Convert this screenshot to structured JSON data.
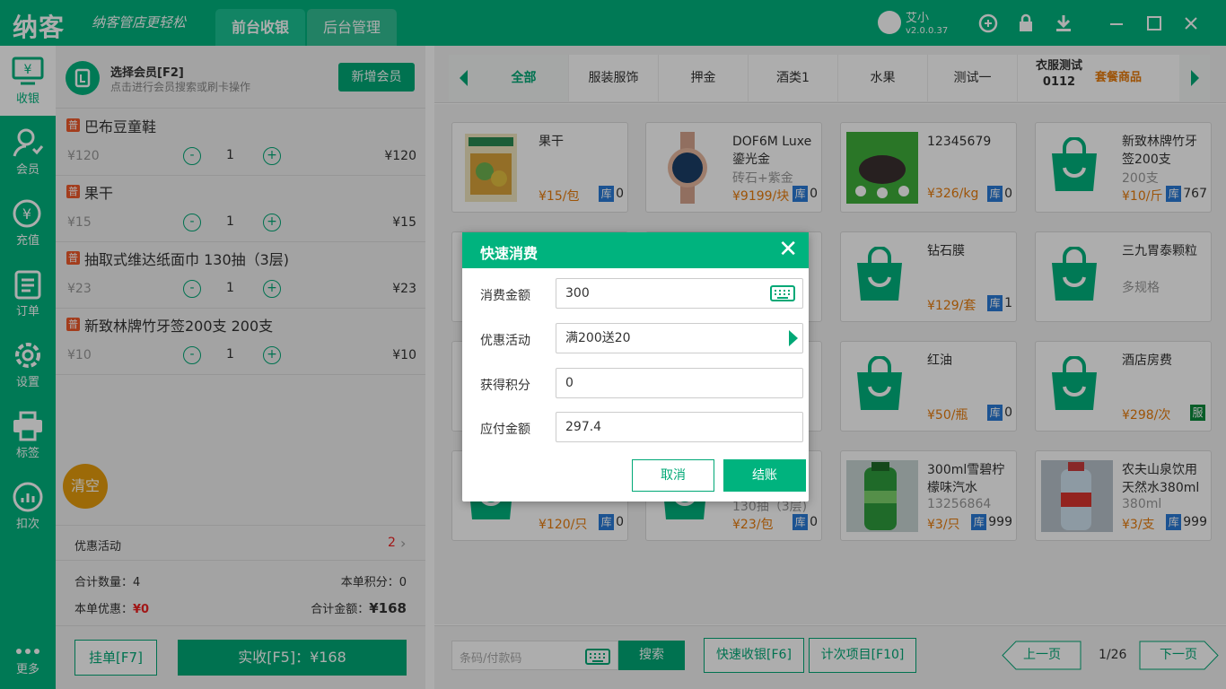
{
  "app": {
    "logo": "纳客",
    "slogan": "纳客管店更轻松",
    "tab_front": "前台收银",
    "tab_back": "后台管理",
    "user_name": "艾小",
    "version": "v2.0.0.37"
  },
  "sidebar": [
    {
      "label": "收银",
      "icon": "cashier-icon"
    },
    {
      "label": "会员",
      "icon": "member-icon"
    },
    {
      "label": "充值",
      "icon": "recharge-icon"
    },
    {
      "label": "订单",
      "icon": "order-icon"
    },
    {
      "label": "设置",
      "icon": "settings-icon"
    },
    {
      "label": "标签",
      "icon": "printer-icon"
    },
    {
      "label": "扣次",
      "icon": "chart-icon"
    },
    {
      "label": "更多",
      "icon": "more-icon"
    }
  ],
  "member": {
    "title": "选择会员[F2]",
    "subtitle": "点击进行会员搜索或刷卡操作",
    "add_label": "新增会员"
  },
  "cart": [
    {
      "tag": "普",
      "name": "巴布豆童鞋",
      "price": "¥120",
      "qty": "1",
      "total": "¥120"
    },
    {
      "tag": "普",
      "name": "果干",
      "price": "¥15",
      "qty": "1",
      "total": "¥15"
    },
    {
      "tag": "普",
      "name": "抽取式维达纸面巾 130抽（3层)",
      "price": "¥23",
      "qty": "1",
      "total": "¥23"
    },
    {
      "tag": "普",
      "name": "新致林牌竹牙签200支 200支",
      "price": "¥10",
      "qty": "1",
      "total": "¥10"
    }
  ],
  "clear_label": "清空",
  "promo": {
    "label": "优惠活动",
    "count": "2"
  },
  "summary": {
    "qty_label": "合计数量：",
    "qty": "4",
    "points_label": "本单积分：",
    "points": "0",
    "discount_label": "本单优惠：",
    "discount": "¥0",
    "amount_label": "合计金额：",
    "amount": "¥168"
  },
  "hang_label": "挂单[F7]",
  "pay_label": "实收[F5]：¥168",
  "categories": [
    "全部",
    "服装服饰",
    "押金",
    "酒类1",
    "水果",
    "测试一"
  ],
  "cat_last": [
    "衣服测试",
    "0112"
  ],
  "cat_set": "套餐商品",
  "products": [
    {
      "name": "果干",
      "sub": "",
      "price": "¥15/包",
      "stock": "0",
      "badge": "库"
    },
    {
      "name": "DOF6M Luxe 鎏光金",
      "sub": "砖石+紫金",
      "price": "¥9199/块",
      "stock": "0",
      "badge": "库"
    },
    {
      "name": "12345679",
      "sub": "",
      "price": "¥326/kg",
      "stock": "0",
      "badge": "库"
    },
    {
      "name": "新致林牌竹牙签200支",
      "sub": "200支",
      "price": "¥10/斤",
      "stock": "767",
      "badge": "库"
    },
    {
      "name": "钻石膜",
      "sub": "",
      "price": "¥129/套",
      "stock": "1",
      "badge": "库"
    },
    {
      "name": "三九胃泰颗粒",
      "sub": "多规格",
      "price": "",
      "stock": "",
      "badge": ""
    },
    {
      "name": "红油",
      "sub": "",
      "price": "¥50/瓶",
      "stock": "0",
      "badge": "库"
    },
    {
      "name": "酒店房费",
      "sub": "",
      "price": "¥298/次",
      "stock": "",
      "badge": "服"
    },
    {
      "name": "",
      "sub": "",
      "price": "¥120/只",
      "stock": "0",
      "badge": "库"
    },
    {
      "name": "",
      "sub": "130抽（3层)",
      "price": "¥23/包",
      "stock": "0",
      "badge": "库"
    },
    {
      "name": "300ml雪碧柠檬味汽水",
      "sub": "13256864",
      "price": "¥3/只",
      "stock": "999",
      "badge": "库"
    },
    {
      "name": "农夫山泉饮用天然水380ml",
      "sub": "380ml",
      "price": "¥3/支",
      "stock": "999",
      "badge": "库"
    }
  ],
  "bottom": {
    "scan_placeholder": "条码/付款码",
    "search_label": "搜索",
    "quick_label": "快速收银[F6]",
    "count_label": "计次项目[F10]",
    "prev_label": "上一页",
    "page": "1/26",
    "next_label": "下一页"
  },
  "dialog": {
    "title": "快速消费",
    "amount_label": "消费金额",
    "amount": "300",
    "promo_label": "优惠活动",
    "promo": "满200送20",
    "points_label": "获得积分",
    "points": "0",
    "payable_label": "应付金额",
    "payable": "297.4",
    "cancel_label": "取消",
    "ok_label": "结账"
  },
  "colors": {
    "brand": "#00b37e",
    "orange": "#e87c0c",
    "stock_blue": "#2a7bd8"
  }
}
